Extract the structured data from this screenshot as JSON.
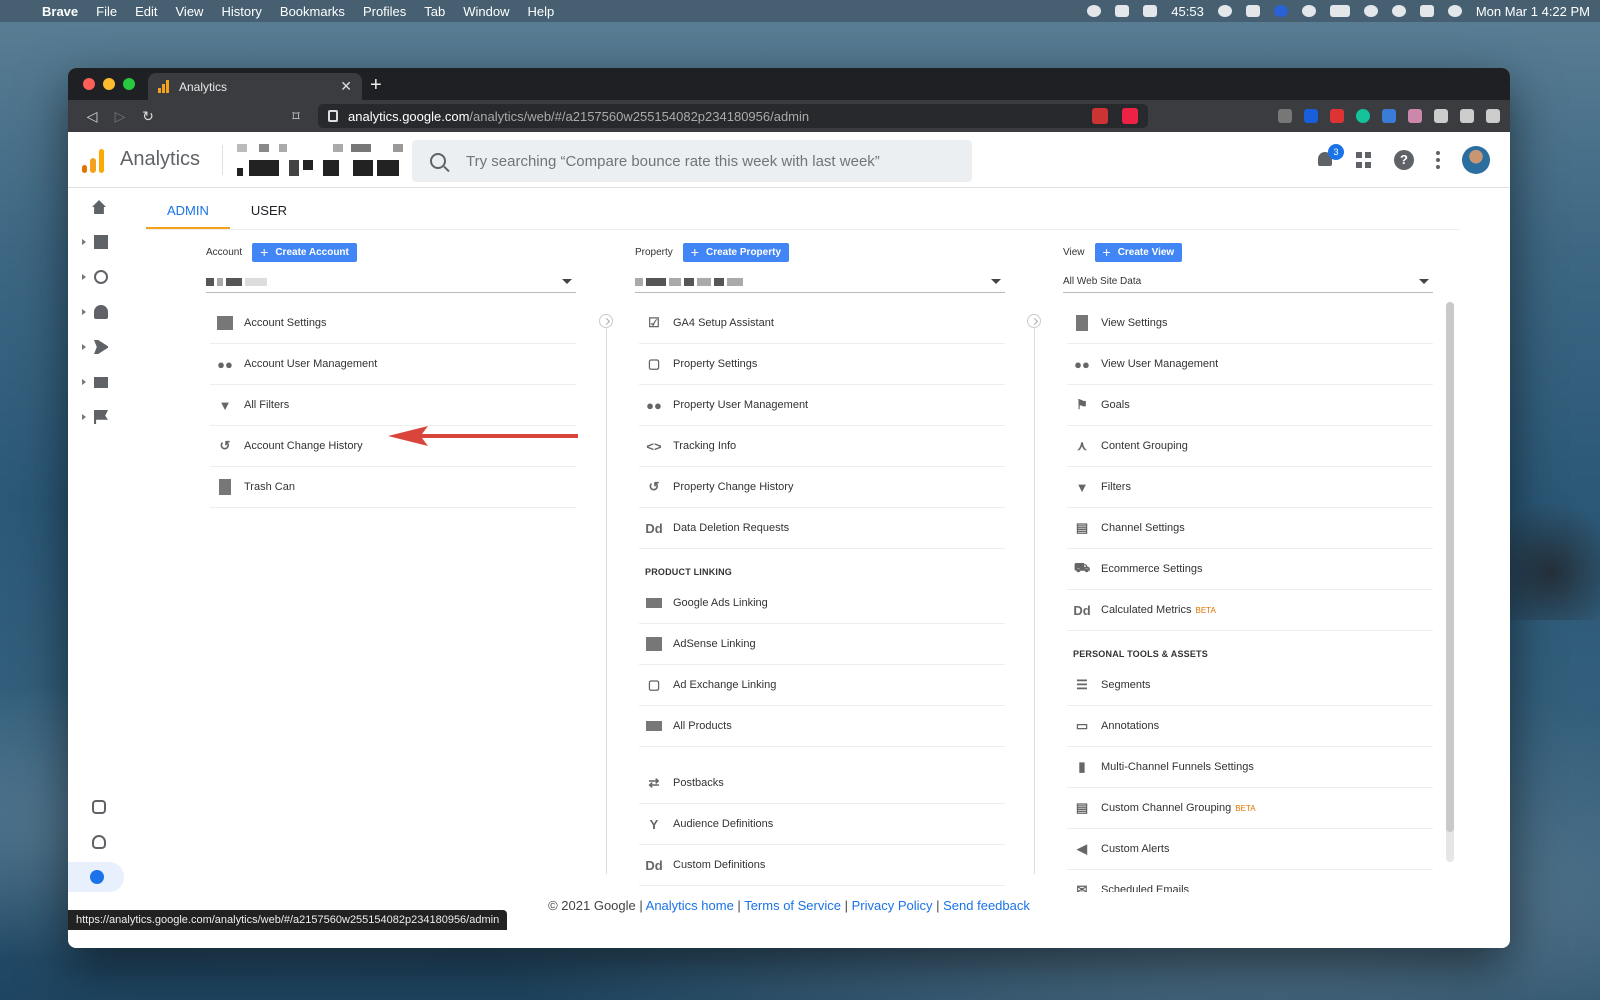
{
  "menubar": {
    "app": "Brave",
    "items": [
      "File",
      "Edit",
      "View",
      "History",
      "Bookmarks",
      "Profiles",
      "Tab",
      "Window",
      "Help"
    ],
    "timer": "45:53",
    "clock": "Mon Mar 1  4:22 PM"
  },
  "browser": {
    "tab_title": "Analytics",
    "url_host": "analytics.google.com",
    "url_path": "/analytics/web/#/a2157560w255154082p234180956/admin",
    "status_url": "https://analytics.google.com/analytics/web/#/a2157560w255154082p234180956/admin"
  },
  "ga": {
    "product": "Analytics",
    "search_placeholder": "Try searching “Compare bounce rate this week with last week”",
    "notification_count": "3"
  },
  "tabs": {
    "admin": "ADMIN",
    "user": "USER"
  },
  "account": {
    "label": "Account",
    "create": "Create Account",
    "items": [
      "Account Settings",
      "Account User Management",
      "All Filters",
      "Account Change History",
      "Trash Can"
    ]
  },
  "property": {
    "label": "Property",
    "create": "Create Property",
    "items": [
      "GA4 Setup Assistant",
      "Property Settings",
      "Property User Management",
      "Tracking Info",
      "Property Change History",
      "Data Deletion Requests"
    ],
    "linking_heading": "PRODUCT LINKING",
    "linking": [
      "Google Ads Linking",
      "AdSense Linking",
      "Ad Exchange Linking",
      "All Products"
    ],
    "other": [
      "Postbacks",
      "Audience Definitions",
      "Custom Definitions"
    ]
  },
  "view": {
    "label": "View",
    "create": "Create View",
    "selected": "All Web Site Data",
    "items": [
      "View Settings",
      "View User Management",
      "Goals",
      "Content Grouping",
      "Filters",
      "Channel Settings",
      "Ecommerce Settings",
      "Calculated Metrics"
    ],
    "beta": "BETA",
    "personal_heading": "PERSONAL TOOLS & ASSETS",
    "personal": [
      "Segments",
      "Annotations",
      "Multi-Channel Funnels Settings",
      "Custom Channel Grouping",
      "Custom Alerts",
      "Scheduled Emails"
    ]
  },
  "footer": {
    "copyright": "© 2021 Google |",
    "links": [
      "Analytics home",
      "Terms of Service",
      "Privacy Policy",
      "Send feedback"
    ]
  },
  "colors": {
    "accent": "#1a73e8",
    "create_button": "#4285f4",
    "arrow": "#d9453a",
    "analytics_orange": "#f4a21b"
  }
}
